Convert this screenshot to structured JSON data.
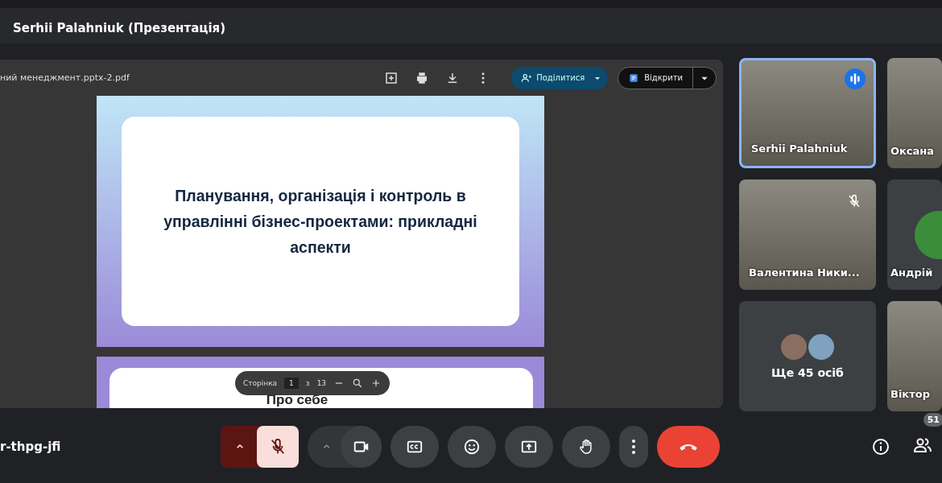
{
  "window": {
    "title": "Serhii Palahniuk (Презентація)"
  },
  "viewer": {
    "file_name": "ний менеджмент.pptx-2.pdf",
    "share_button": "Поділитися",
    "open_button": "Відкрити",
    "slides": [
      {
        "kind": "title",
        "title": "Планування, організація і контроль в управлінні бізнес-проектами: прикладні аспекти"
      },
      {
        "kind": "partial",
        "title": "Про себе"
      }
    ],
    "page_control": {
      "label": "Сторінка",
      "current": "1",
      "separator": "з",
      "total": "13"
    }
  },
  "tiles": [
    {
      "name": "Serhii Palahniuk",
      "kind": "video",
      "speaking": true,
      "muted": false
    },
    {
      "name": "Оксана",
      "kind": "video",
      "speaking": false,
      "muted": false
    },
    {
      "name": "Валентина Ники...",
      "kind": "video",
      "speaking": false,
      "muted": true
    },
    {
      "name": "Андрій",
      "kind": "avatar",
      "speaking": false,
      "muted": false
    },
    {
      "name": "Ще 45 осіб",
      "kind": "more",
      "speaking": false,
      "muted": false
    },
    {
      "name": "Віктор",
      "kind": "video",
      "speaking": false,
      "muted": false
    }
  ],
  "controls": {
    "meeting_code": "r-thpg-jfi",
    "mic_on": false,
    "participants_count": "51"
  }
}
